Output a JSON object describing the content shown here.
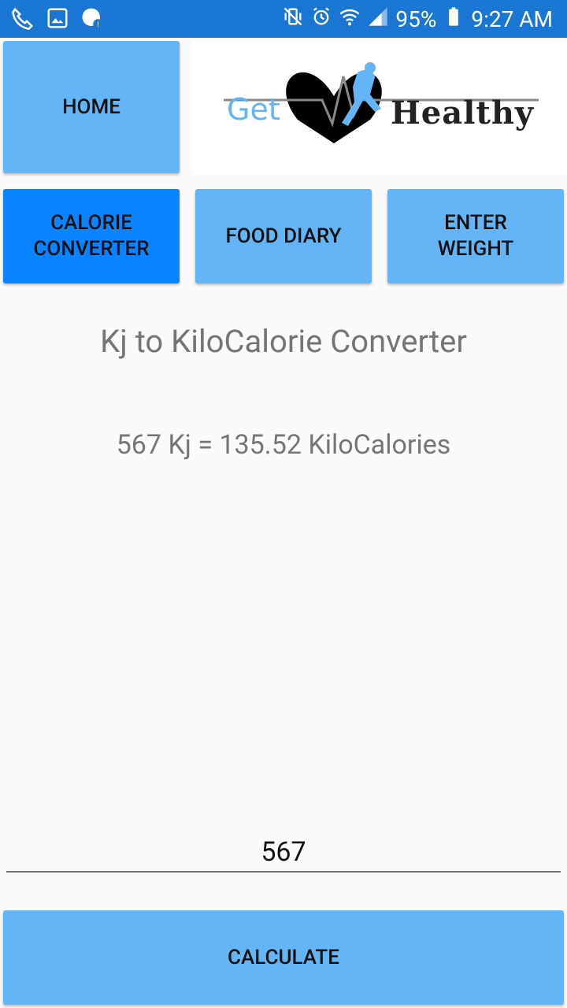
{
  "status": {
    "battery": "95%",
    "time": "9:27 AM"
  },
  "nav": {
    "home": "HOME",
    "calorie_converter_l1": "CALORIE",
    "calorie_converter_l2": "CONVERTER",
    "food_diary": "FOOD DIARY",
    "enter_weight_l1": "ENTER",
    "enter_weight_l2": "WEIGHT"
  },
  "logo": {
    "text_get": "Get",
    "text_healthy": "Healthy"
  },
  "converter": {
    "title": "Kj to KiloCalorie Converter",
    "result": "567 Kj = 135.52 KiloCalories",
    "input_value": "567"
  },
  "actions": {
    "calculate": "CALCULATE"
  },
  "colors": {
    "statusbar": "#1976d2",
    "button": "#64b5f6",
    "button_active": "#0a84ff",
    "logo_blue": "#64b5f6"
  }
}
